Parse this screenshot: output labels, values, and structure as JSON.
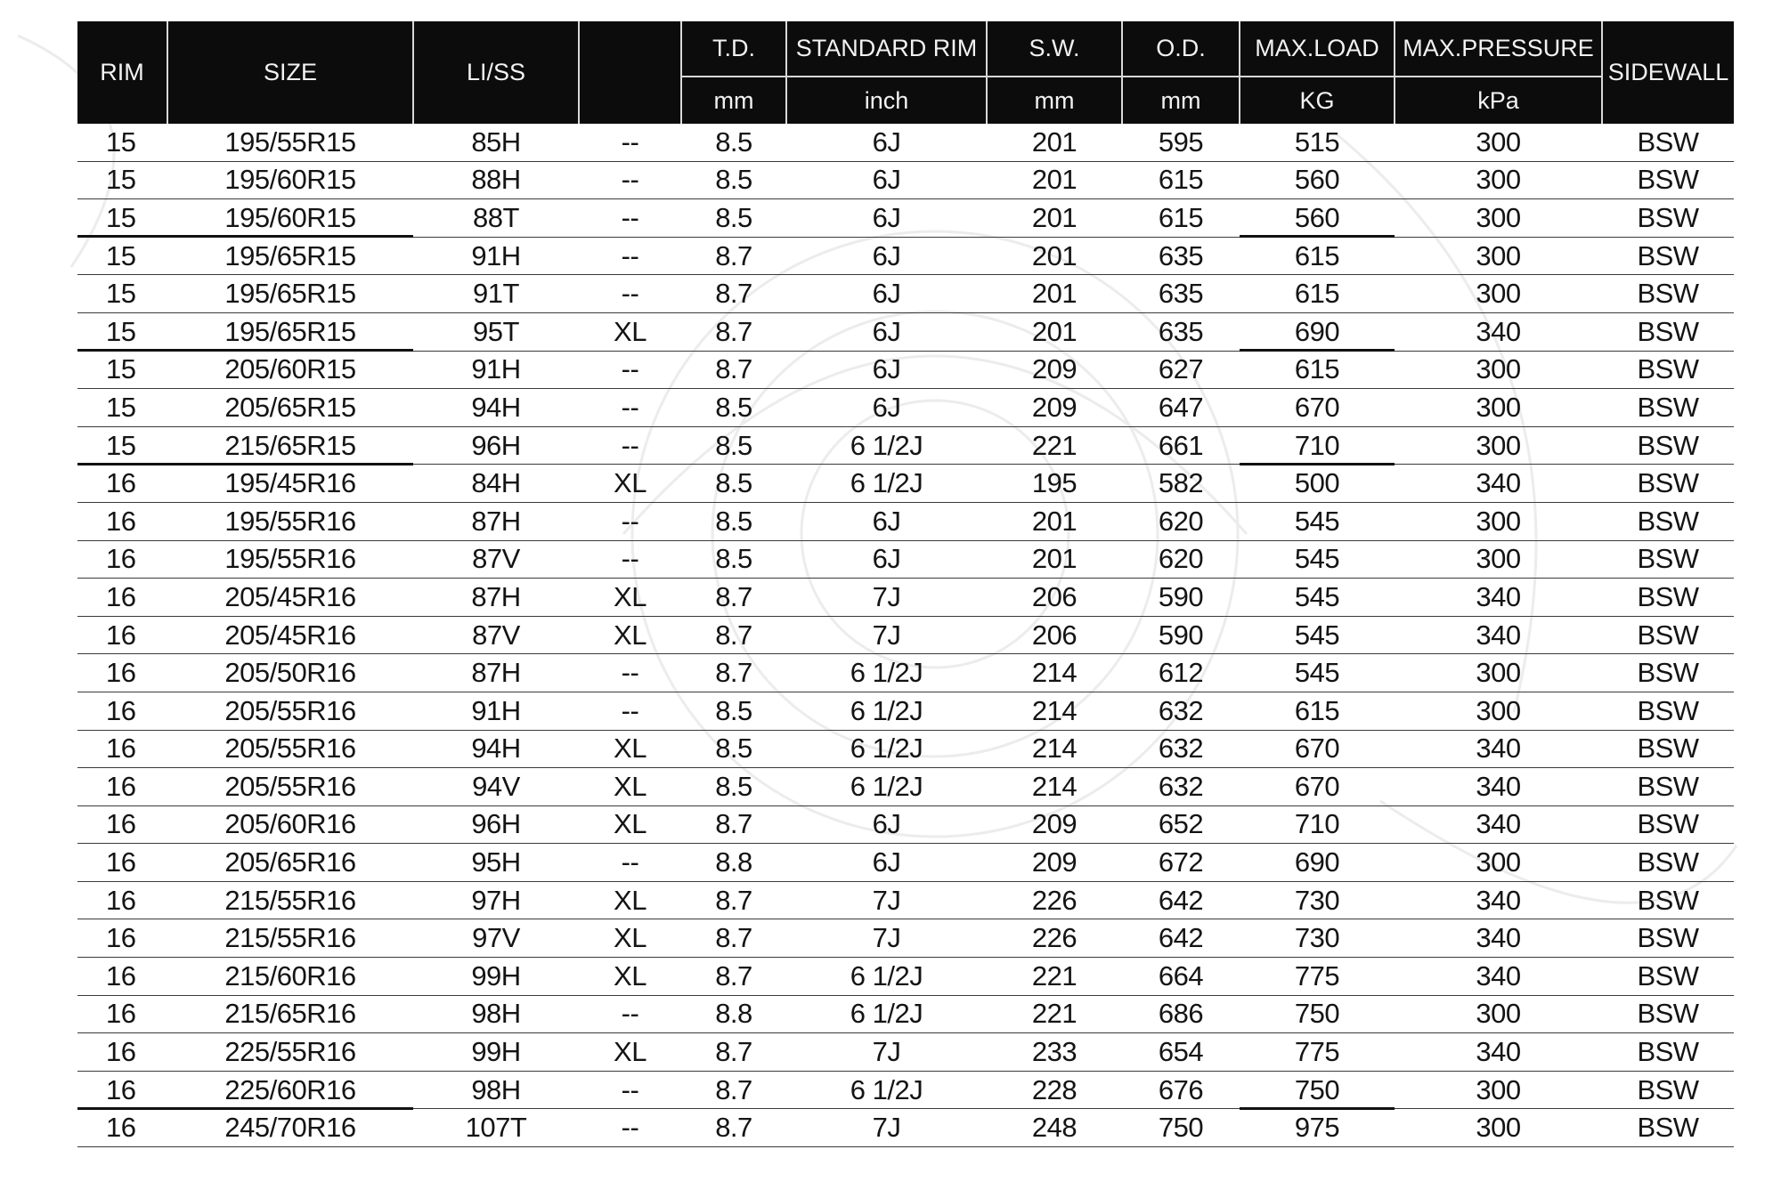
{
  "table": {
    "headers": {
      "rim": "RIM",
      "size": "SIZE",
      "li_ss": "LI/SS",
      "xl": "",
      "td": "T.D.",
      "td_unit": "mm",
      "standard_rim": "STANDARD RIM",
      "standard_rim_unit": "inch",
      "sw": "S.W.",
      "sw_unit": "mm",
      "od": "O.D.",
      "od_unit": "mm",
      "max_load": "MAX.LOAD",
      "max_load_unit": "KG",
      "max_pressure": "MAX.PRESSURE",
      "max_pressure_unit": "kPa",
      "sidewall": "SIDEWALL"
    },
    "rows": [
      {
        "rim": "15",
        "size": "195/55R15",
        "li_ss": "85H",
        "xl": "--",
        "td": "8.5",
        "standard_rim": "6J",
        "sw": "201",
        "od": "595",
        "max_load": "515",
        "max_pressure": "300",
        "sidewall": "BSW"
      },
      {
        "rim": "15",
        "size": "195/60R15",
        "li_ss": "88H",
        "xl": "--",
        "td": "8.5",
        "standard_rim": "6J",
        "sw": "201",
        "od": "615",
        "max_load": "560",
        "max_pressure": "300",
        "sidewall": "BSW"
      },
      {
        "rim": "15",
        "size": "195/60R15",
        "li_ss": "88T",
        "xl": "--",
        "td": "8.5",
        "standard_rim": "6J",
        "sw": "201",
        "od": "615",
        "max_load": "560",
        "max_pressure": "300",
        "sidewall": "BSW"
      },
      {
        "rim": "15",
        "size": "195/65R15",
        "li_ss": "91H",
        "xl": "--",
        "td": "8.7",
        "standard_rim": "6J",
        "sw": "201",
        "od": "635",
        "max_load": "615",
        "max_pressure": "300",
        "sidewall": "BSW"
      },
      {
        "rim": "15",
        "size": "195/65R15",
        "li_ss": "91T",
        "xl": "--",
        "td": "8.7",
        "standard_rim": "6J",
        "sw": "201",
        "od": "635",
        "max_load": "615",
        "max_pressure": "300",
        "sidewall": "BSW"
      },
      {
        "rim": "15",
        "size": "195/65R15",
        "li_ss": "95T",
        "xl": "XL",
        "td": "8.7",
        "standard_rim": "6J",
        "sw": "201",
        "od": "635",
        "max_load": "690",
        "max_pressure": "340",
        "sidewall": "BSW"
      },
      {
        "rim": "15",
        "size": "205/60R15",
        "li_ss": "91H",
        "xl": "--",
        "td": "8.7",
        "standard_rim": "6J",
        "sw": "209",
        "od": "627",
        "max_load": "615",
        "max_pressure": "300",
        "sidewall": "BSW"
      },
      {
        "rim": "15",
        "size": "205/65R15",
        "li_ss": "94H",
        "xl": "--",
        "td": "8.5",
        "standard_rim": "6J",
        "sw": "209",
        "od": "647",
        "max_load": "670",
        "max_pressure": "300",
        "sidewall": "BSW"
      },
      {
        "rim": "15",
        "size": "215/65R15",
        "li_ss": "96H",
        "xl": "--",
        "td": "8.5",
        "standard_rim": "6 1/2J",
        "sw": "221",
        "od": "661",
        "max_load": "710",
        "max_pressure": "300",
        "sidewall": "BSW"
      },
      {
        "rim": "16",
        "size": "195/45R16",
        "li_ss": "84H",
        "xl": "XL",
        "td": "8.5",
        "standard_rim": "6 1/2J",
        "sw": "195",
        "od": "582",
        "max_load": "500",
        "max_pressure": "340",
        "sidewall": "BSW"
      },
      {
        "rim": "16",
        "size": "195/55R16",
        "li_ss": "87H",
        "xl": "--",
        "td": "8.5",
        "standard_rim": "6J",
        "sw": "201",
        "od": "620",
        "max_load": "545",
        "max_pressure": "300",
        "sidewall": "BSW"
      },
      {
        "rim": "16",
        "size": "195/55R16",
        "li_ss": "87V",
        "xl": "--",
        "td": "8.5",
        "standard_rim": "6J",
        "sw": "201",
        "od": "620",
        "max_load": "545",
        "max_pressure": "300",
        "sidewall": "BSW"
      },
      {
        "rim": "16",
        "size": "205/45R16",
        "li_ss": "87H",
        "xl": "XL",
        "td": "8.7",
        "standard_rim": "7J",
        "sw": "206",
        "od": "590",
        "max_load": "545",
        "max_pressure": "340",
        "sidewall": "BSW"
      },
      {
        "rim": "16",
        "size": "205/45R16",
        "li_ss": "87V",
        "xl": "XL",
        "td": "8.7",
        "standard_rim": "7J",
        "sw": "206",
        "od": "590",
        "max_load": "545",
        "max_pressure": "340",
        "sidewall": "BSW"
      },
      {
        "rim": "16",
        "size": "205/50R16",
        "li_ss": "87H",
        "xl": "--",
        "td": "8.7",
        "standard_rim": "6 1/2J",
        "sw": "214",
        "od": "612",
        "max_load": "545",
        "max_pressure": "300",
        "sidewall": "BSW"
      },
      {
        "rim": "16",
        "size": "205/55R16",
        "li_ss": "91H",
        "xl": "--",
        "td": "8.5",
        "standard_rim": "6 1/2J",
        "sw": "214",
        "od": "632",
        "max_load": "615",
        "max_pressure": "300",
        "sidewall": "BSW"
      },
      {
        "rim": "16",
        "size": "205/55R16",
        "li_ss": "94H",
        "xl": "XL",
        "td": "8.5",
        "standard_rim": "6 1/2J",
        "sw": "214",
        "od": "632",
        "max_load": "670",
        "max_pressure": "340",
        "sidewall": "BSW"
      },
      {
        "rim": "16",
        "size": "205/55R16",
        "li_ss": "94V",
        "xl": "XL",
        "td": "8.5",
        "standard_rim": "6 1/2J",
        "sw": "214",
        "od": "632",
        "max_load": "670",
        "max_pressure": "340",
        "sidewall": "BSW"
      },
      {
        "rim": "16",
        "size": "205/60R16",
        "li_ss": "96H",
        "xl": "XL",
        "td": "8.7",
        "standard_rim": "6J",
        "sw": "209",
        "od": "652",
        "max_load": "710",
        "max_pressure": "340",
        "sidewall": "BSW"
      },
      {
        "rim": "16",
        "size": "205/65R16",
        "li_ss": "95H",
        "xl": "--",
        "td": "8.8",
        "standard_rim": "6J",
        "sw": "209",
        "od": "672",
        "max_load": "690",
        "max_pressure": "300",
        "sidewall": "BSW"
      },
      {
        "rim": "16",
        "size": "215/55R16",
        "li_ss": "97H",
        "xl": "XL",
        "td": "8.7",
        "standard_rim": "7J",
        "sw": "226",
        "od": "642",
        "max_load": "730",
        "max_pressure": "340",
        "sidewall": "BSW"
      },
      {
        "rim": "16",
        "size": "215/55R16",
        "li_ss": "97V",
        "xl": "XL",
        "td": "8.7",
        "standard_rim": "7J",
        "sw": "226",
        "od": "642",
        "max_load": "730",
        "max_pressure": "340",
        "sidewall": "BSW"
      },
      {
        "rim": "16",
        "size": "215/60R16",
        "li_ss": "99H",
        "xl": "XL",
        "td": "8.7",
        "standard_rim": "6 1/2J",
        "sw": "221",
        "od": "664",
        "max_load": "775",
        "max_pressure": "340",
        "sidewall": "BSW"
      },
      {
        "rim": "16",
        "size": "215/65R16",
        "li_ss": "98H",
        "xl": "--",
        "td": "8.8",
        "standard_rim": "6 1/2J",
        "sw": "221",
        "od": "686",
        "max_load": "750",
        "max_pressure": "300",
        "sidewall": "BSW"
      },
      {
        "rim": "16",
        "size": "225/55R16",
        "li_ss": "99H",
        "xl": "XL",
        "td": "8.7",
        "standard_rim": "7J",
        "sw": "233",
        "od": "654",
        "max_load": "775",
        "max_pressure": "340",
        "sidewall": "BSW"
      },
      {
        "rim": "16",
        "size": "225/60R16",
        "li_ss": "98H",
        "xl": "--",
        "td": "8.7",
        "standard_rim": "6 1/2J",
        "sw": "228",
        "od": "676",
        "max_load": "750",
        "max_pressure": "300",
        "sidewall": "BSW"
      },
      {
        "rim": "16",
        "size": "245/70R16",
        "li_ss": "107T",
        "xl": "--",
        "td": "8.7",
        "standard_rim": "7J",
        "sw": "248",
        "od": "750",
        "max_load": "975",
        "max_pressure": "300",
        "sidewall": "BSW"
      }
    ]
  }
}
